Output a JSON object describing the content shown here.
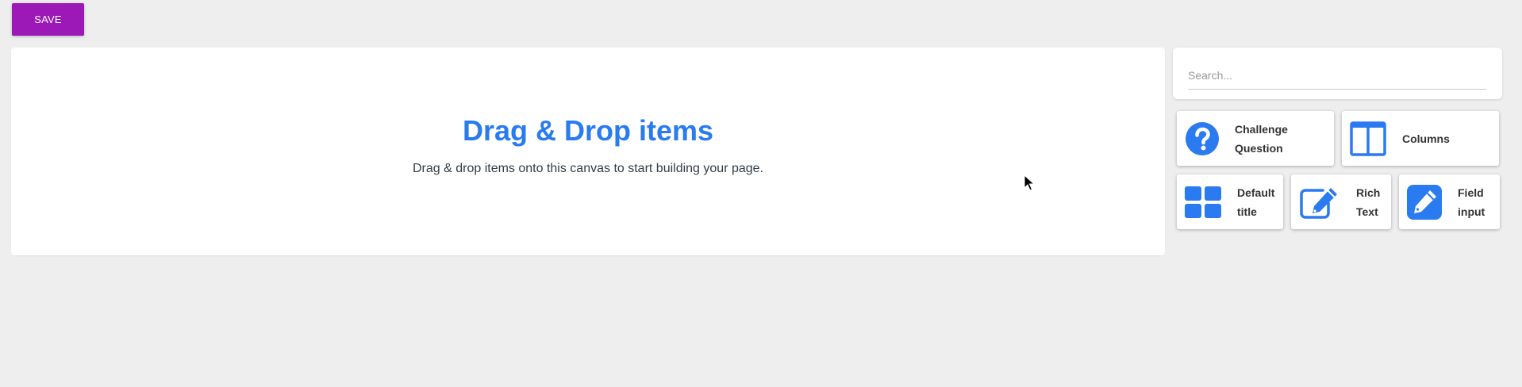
{
  "toolbar": {
    "save_label": "SAVE",
    "save_color": "#9c19b8"
  },
  "canvas": {
    "title": "Drag & Drop items",
    "subtitle": "Drag & drop items onto this canvas to start building your page.",
    "title_color": "#2a7af0"
  },
  "search": {
    "placeholder": "Search..."
  },
  "widgets": [
    {
      "label": "Challenge Question",
      "icon": "question-circle-icon"
    },
    {
      "label": "Columns",
      "icon": "columns-icon"
    },
    {
      "label": "Default title",
      "icon": "grid-icon"
    },
    {
      "label": "Rich Text",
      "icon": "edit-square-icon"
    },
    {
      "label": "Field input",
      "icon": "pencil-box-icon"
    }
  ],
  "icon_color": "#2a7af0"
}
